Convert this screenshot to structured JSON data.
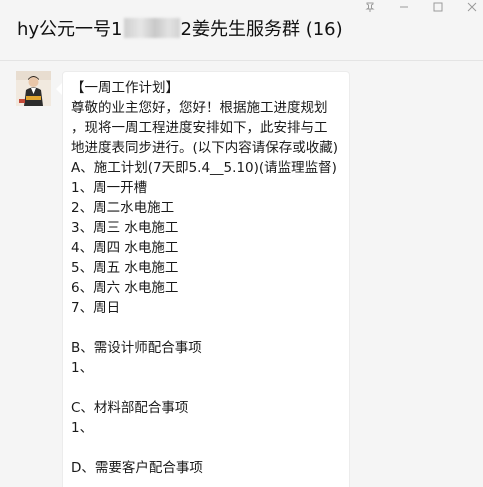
{
  "header": {
    "title_prefix": "hy公元一号1",
    "title_suffix": "2姜先生服务群 (16)"
  },
  "icons": {
    "window_controls": [
      "pin-icon",
      "minimize-icon",
      "maximize-icon",
      "close-icon"
    ]
  },
  "message": {
    "lines": [
      "【一周工作计划】",
      "尊敬的业主您好，您好！根据施工进度规划",
      "，现将一周工程进度安排如下，此安排与工",
      "地进度表同步进行。(以下内容请保存或收藏)",
      "A、施工计划(7天即5.4__5.10)(请监理监督)",
      "1、周一开槽",
      "2、周二水电施工",
      "3、周三  水电施工",
      "4、周四 水电施工",
      "5、周五 水电施工",
      "6、周六 水电施工",
      "7、周日",
      "",
      "B、需设计师配合事项",
      "1、",
      "",
      "C、材料部配合事项",
      "1、",
      "",
      "D、需要客户配合事项"
    ]
  },
  "colors": {
    "background": "#f5f5f5",
    "bubble": "#ffffff",
    "text": "#1a1a1a"
  }
}
